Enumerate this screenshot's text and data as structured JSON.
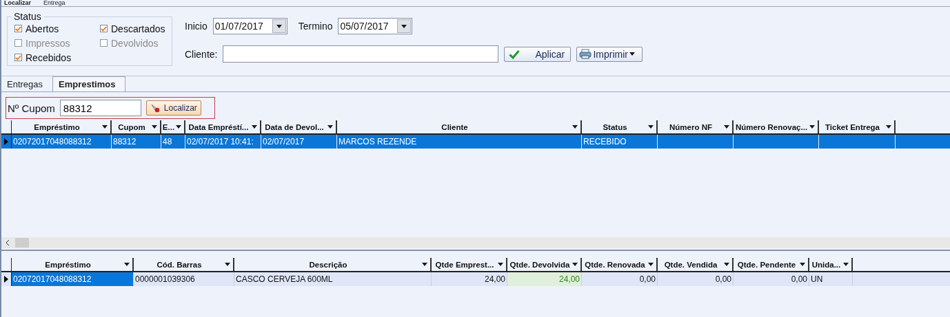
{
  "top_tabs": [
    {
      "label": "Localizar",
      "selected": true
    },
    {
      "label": "Entrega",
      "selected": false
    }
  ],
  "status": {
    "title": "Status",
    "options": [
      {
        "label": "Abertos",
        "checked": true,
        "disabled": false
      },
      {
        "label": "Descartados",
        "checked": true,
        "disabled": false
      },
      {
        "label": "Impressos",
        "checked": false,
        "disabled": true
      },
      {
        "label": "Devolvidos",
        "checked": false,
        "disabled": true
      },
      {
        "label": "Recebidos",
        "checked": true,
        "disabled": false
      }
    ]
  },
  "filters": {
    "start_label": "Inicio",
    "start_value": "01/07/2017",
    "end_label": "Termino",
    "end_value": "05/07/2017",
    "client_label": "Cliente:"
  },
  "buttons": [
    {
      "label": "Aplicar",
      "kind": "apply"
    },
    {
      "label": "Imprimir",
      "kind": "print"
    }
  ],
  "sub_tabs": [
    {
      "label": "Entregas",
      "selected": false
    },
    {
      "label": "Emprestimos",
      "selected": true
    }
  ],
  "coupon": {
    "label": "Nº Cupom",
    "value": "88312",
    "button": "Localizar"
  },
  "loans_table": {
    "columns": [
      {
        "label": "Empréstimo"
      },
      {
        "label": "Cupom"
      },
      {
        "label": "E..."
      },
      {
        "label": "Data Empréstí..."
      },
      {
        "label": "Data de Devol..."
      },
      {
        "label": "Cliente"
      },
      {
        "label": "Status"
      },
      {
        "label": "Número NF"
      },
      {
        "label": "Número Renovaç..."
      },
      {
        "label": "Ticket Entrega"
      }
    ],
    "rows": [
      {
        "selected": true,
        "cells": [
          "02072017048088312",
          "88312",
          "48",
          "02/07/2017 10:41:",
          "02/07/2017",
          "MARCOS REZENDE",
          "RECEBIDO",
          "",
          "",
          ""
        ]
      }
    ]
  },
  "items_table": {
    "columns": [
      {
        "label": "Empréstimo",
        "kind": "text"
      },
      {
        "label": "Cód. Barras",
        "kind": "text"
      },
      {
        "label": "Descrição",
        "kind": "text"
      },
      {
        "label": "Qtde Emprest...",
        "kind": "number"
      },
      {
        "label": "Qtde. Devolvida",
        "kind": "returned"
      },
      {
        "label": "Qtde. Renovada",
        "kind": "number"
      },
      {
        "label": "Qtde. Vendida",
        "kind": "number"
      },
      {
        "label": "Qtde. Pendente",
        "kind": "number"
      },
      {
        "label": "Unida...",
        "kind": "text"
      }
    ],
    "rows": [
      {
        "selected": false,
        "cells": [
          {
            "text": "02072017048088312",
            "focused": true
          },
          {
            "text": "0000001039306",
            "focused": false
          },
          {
            "text": "CASCO CERVEJA 600ML",
            "focused": false
          },
          {
            "text": "24,00",
            "focused": false
          },
          {
            "text": "24,00",
            "focused": false
          },
          {
            "text": "0,00",
            "focused": false
          },
          {
            "text": "0,00",
            "focused": false
          },
          {
            "text": "0,00",
            "focused": false
          },
          {
            "text": "UN",
            "focused": false
          }
        ]
      }
    ]
  }
}
